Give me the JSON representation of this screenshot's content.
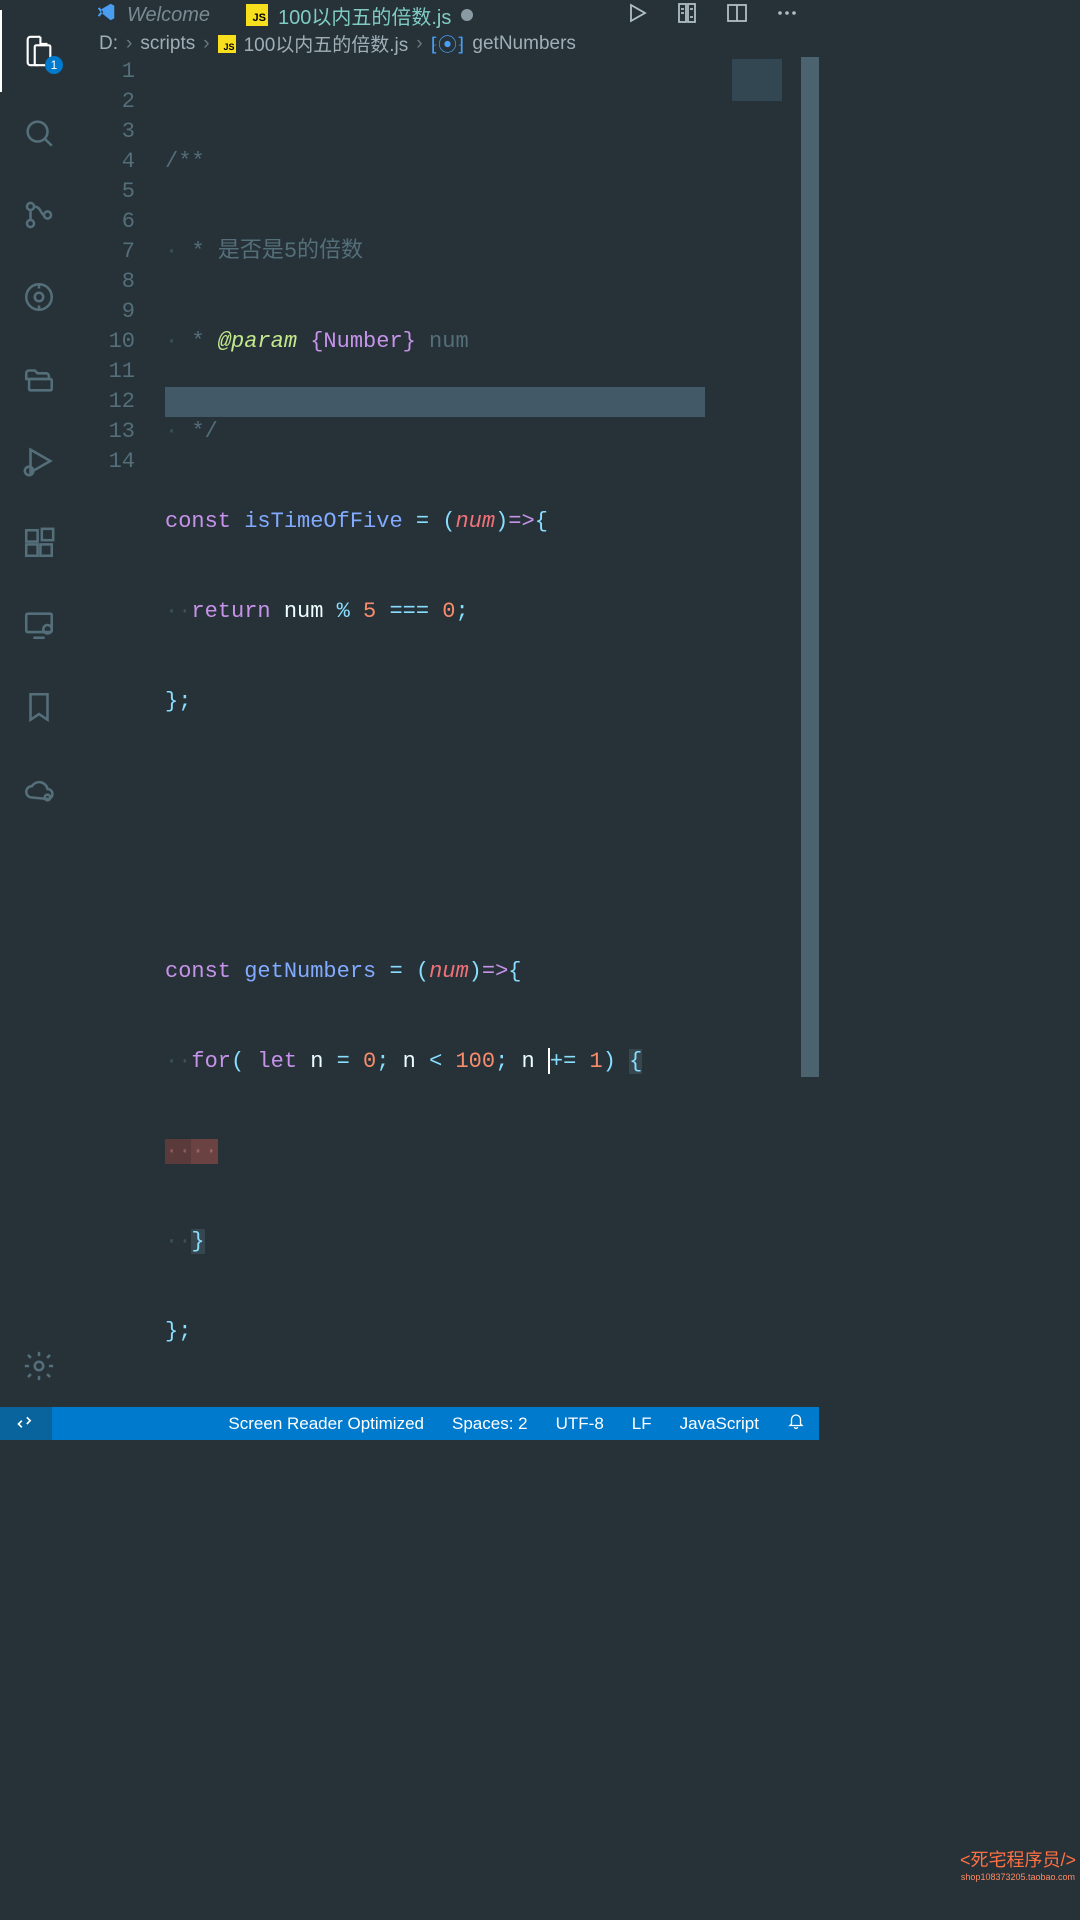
{
  "tabs": {
    "welcome": "Welcome",
    "file": "100以内五的倍数.js"
  },
  "breadcrumbs": {
    "drive": "D:",
    "folder": "scripts",
    "file": "100以内五的倍数.js",
    "symbol": "getNumbers"
  },
  "activitybar": {
    "badge": "1"
  },
  "code": {
    "l1": "/**",
    "l2_star": " * ",
    "l2_text": "是否是5的倍数",
    "l3_star": " * ",
    "l3_tag": "@param",
    "l3_type": "{Number}",
    "l3_name": " num",
    "l4": " */",
    "l5_const": "const",
    "l5_fn": "isTimeOfFive",
    "l5_eq": " = ",
    "l5_p1": "(",
    "l5_arg": "num",
    "l5_p2": ")",
    "l5_arrow": "=>",
    "l5_brace": "{",
    "l6_return": "return",
    "l6_expr1": " num ",
    "l6_op1": "%",
    "l6_sp": " ",
    "l6_n5": "5",
    "l6_eqeq": " === ",
    "l6_n0": "0",
    "l6_semi": ";",
    "l7": "};",
    "l10_const": "const",
    "l10_fn": "getNumbers",
    "l10_eq": " = ",
    "l10_p1": "(",
    "l10_arg": "num",
    "l10_p2": ")",
    "l10_arrow": "=>",
    "l10_brace": "{",
    "l11_for": "for",
    "l11_p1": "(",
    "l11_let": " let",
    "l11_n": " n ",
    "l11_eq": "=",
    "l11_sp1": " ",
    "l11_0": "0",
    "l11_semi1": ";",
    "l11_n2": " n ",
    "l11_lt": "<",
    "l11_sp2": " ",
    "l11_100": "100",
    "l11_semi2": ";",
    "l11_n3": " n ",
    "l11_pluseq": "+=",
    "l11_sp3": " ",
    "l11_1": "1",
    "l11_p2": ")",
    "l11_sp4": " ",
    "l11_brace": "{",
    "l13_brace": "}",
    "l14": "};"
  },
  "lineNumbers": [
    "1",
    "2",
    "3",
    "4",
    "5",
    "6",
    "7",
    "8",
    "9",
    "10",
    "11",
    "12",
    "13",
    "14"
  ],
  "statusbar": {
    "screenreader": "Screen Reader Optimized",
    "spaces": "Spaces: 2",
    "encoding": "UTF-8",
    "eol": "LF",
    "lang": "JavaScript"
  },
  "watermark": {
    "main": "<死宅程序员/>",
    "sub": "shop108373205.taobao.com"
  }
}
